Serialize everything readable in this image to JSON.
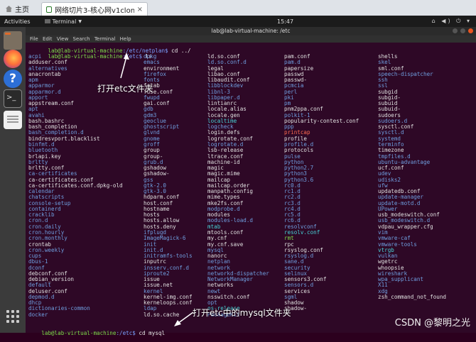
{
  "vm_tabs": {
    "home": "主页",
    "active": "网络切片3-核心网v1clone...",
    "close_glyph": "×"
  },
  "topbar": {
    "activities": "Activities",
    "app": "Terminal",
    "clock": "15:47",
    "system_icons": "⌂ ◀) ⏻ ▾"
  },
  "terminal": {
    "title": "lab@lab-virtual-machine: /etc",
    "menu": "File Edit View Search Terminal Help",
    "lines": [
      {
        "user": "lab@lab-virtual-machine",
        "path": ":/etc/netplan$",
        "cmd": " cd ../"
      },
      {
        "user": "lab@lab-virtual-machine",
        "path": ":/etc$",
        "cmd": " ls"
      }
    ],
    "last_line": {
      "user": "lab@lab-virtual-machine",
      "path": ":/etc$",
      "cmd": " cd mysql"
    },
    "columns": [
      [
        {
          "t": "acpi",
          "k": "dir"
        },
        {
          "t": "adduser.conf",
          "k": "plain"
        },
        {
          "t": "alternatives",
          "k": "dir"
        },
        {
          "t": "anacrontab",
          "k": "plain"
        },
        {
          "t": "apm",
          "k": "dir"
        },
        {
          "t": "apparmor",
          "k": "dir"
        },
        {
          "t": "apparmor.d",
          "k": "dir"
        },
        {
          "t": "apport",
          "k": "dir"
        },
        {
          "t": "appstream.conf",
          "k": "plain"
        },
        {
          "t": "apt",
          "k": "dir"
        },
        {
          "t": "avahi",
          "k": "dir"
        },
        {
          "t": "bash.bashrc",
          "k": "plain"
        },
        {
          "t": "bash_completion",
          "k": "plain"
        },
        {
          "t": "bash_completion.d",
          "k": "dir"
        },
        {
          "t": "bindresvport.blacklist",
          "k": "plain"
        },
        {
          "t": "binfmt.d",
          "k": "dir"
        },
        {
          "t": "bluetooth",
          "k": "dir"
        },
        {
          "t": "brlapi.key",
          "k": "plain"
        },
        {
          "t": "brltty",
          "k": "dir"
        },
        {
          "t": "brltty.conf",
          "k": "plain"
        },
        {
          "t": "ca-certificates",
          "k": "dir"
        },
        {
          "t": "ca-certificates.conf",
          "k": "plain"
        },
        {
          "t": "ca-certificates.conf.dpkg-old",
          "k": "plain"
        },
        {
          "t": "calendar",
          "k": "dir"
        },
        {
          "t": "chatscripts",
          "k": "dir"
        },
        {
          "t": "console-setup",
          "k": "dir"
        },
        {
          "t": "containerd",
          "k": "dir"
        },
        {
          "t": "cracklib",
          "k": "dir"
        },
        {
          "t": "cron.d",
          "k": "dir"
        },
        {
          "t": "cron.daily",
          "k": "dir"
        },
        {
          "t": "cron.hourly",
          "k": "dir"
        },
        {
          "t": "cron.monthly",
          "k": "dir"
        },
        {
          "t": "crontab",
          "k": "plain"
        },
        {
          "t": "cron.weekly",
          "k": "dir"
        },
        {
          "t": "cups",
          "k": "dir"
        },
        {
          "t": "dbus-1",
          "k": "dir"
        },
        {
          "t": "dconf",
          "k": "dir"
        },
        {
          "t": "debconf.conf",
          "k": "plain"
        },
        {
          "t": "debian_version",
          "k": "plain"
        },
        {
          "t": "default",
          "k": "dir"
        },
        {
          "t": "deluser.conf",
          "k": "plain"
        },
        {
          "t": "depmod.d",
          "k": "dir"
        },
        {
          "t": "dhcp",
          "k": "dir"
        },
        {
          "t": "dictionaries-common",
          "k": "dir"
        },
        {
          "t": "docker",
          "k": "dir"
        }
      ],
      [
        {
          "t": "dpkg",
          "k": "dir"
        },
        {
          "t": "emacs",
          "k": "dir"
        },
        {
          "t": "environment",
          "k": "plain"
        },
        {
          "t": "firefox",
          "k": "dir"
        },
        {
          "t": "fonts",
          "k": "dir"
        },
        {
          "t": "fstab",
          "k": "plain"
        },
        {
          "t": "fuse.conf",
          "k": "plain"
        },
        {
          "t": "fwupd",
          "k": "dir"
        },
        {
          "t": "gai.conf",
          "k": "plain"
        },
        {
          "t": "gdb",
          "k": "dir"
        },
        {
          "t": "gdm3",
          "k": "dir"
        },
        {
          "t": "geoclue",
          "k": "dir"
        },
        {
          "t": "ghostscript",
          "k": "dir"
        },
        {
          "t": "glvnd",
          "k": "dir"
        },
        {
          "t": "gnome",
          "k": "dir"
        },
        {
          "t": "groff",
          "k": "dir"
        },
        {
          "t": "group",
          "k": "plain"
        },
        {
          "t": "group-",
          "k": "plain"
        },
        {
          "t": "grub.d",
          "k": "dir"
        },
        {
          "t": "gshadow",
          "k": "plain"
        },
        {
          "t": "gshadow-",
          "k": "plain"
        },
        {
          "t": "gss",
          "k": "dir"
        },
        {
          "t": "gtk-2.0",
          "k": "dir"
        },
        {
          "t": "gtk-3.0",
          "k": "dir"
        },
        {
          "t": "hdparm.conf",
          "k": "plain"
        },
        {
          "t": "host.conf",
          "k": "plain"
        },
        {
          "t": "hostname",
          "k": "plain"
        },
        {
          "t": "hosts",
          "k": "plain"
        },
        {
          "t": "hosts.allow",
          "k": "plain"
        },
        {
          "t": "hosts.deny",
          "k": "plain"
        },
        {
          "t": "ifplugd",
          "k": "dir"
        },
        {
          "t": "ImageMagick-6",
          "k": "dir"
        },
        {
          "t": "init",
          "k": "dir"
        },
        {
          "t": "init.d",
          "k": "dir"
        },
        {
          "t": "initramfs-tools",
          "k": "dir"
        },
        {
          "t": "inputrc",
          "k": "plain"
        },
        {
          "t": "insserv.conf.d",
          "k": "dir"
        },
        {
          "t": "iproute2",
          "k": "dir"
        },
        {
          "t": "issue",
          "k": "plain"
        },
        {
          "t": "issue.net",
          "k": "plain"
        },
        {
          "t": "kernel",
          "k": "dir"
        },
        {
          "t": "kernel-img.conf",
          "k": "plain"
        },
        {
          "t": "kerneloops.conf",
          "k": "plain"
        },
        {
          "t": "ldap",
          "k": "dir"
        },
        {
          "t": "ld.so.cache",
          "k": "plain"
        }
      ],
      [
        {
          "t": "ld.so.conf",
          "k": "plain"
        },
        {
          "t": "ld.so.conf.d",
          "k": "dir"
        },
        {
          "t": "legal",
          "k": "plain"
        },
        {
          "t": "libao.conf",
          "k": "plain"
        },
        {
          "t": "libaudit.conf",
          "k": "plain"
        },
        {
          "t": "libblockdev",
          "k": "dir"
        },
        {
          "t": "libnl-3",
          "k": "dir"
        },
        {
          "t": "libpaper.d",
          "k": "dir"
        },
        {
          "t": "lintianrc",
          "k": "plain"
        },
        {
          "t": "locale.alias",
          "k": "plain"
        },
        {
          "t": "locale.gen",
          "k": "plain"
        },
        {
          "t": "localtime",
          "k": "link"
        },
        {
          "t": "logcheck",
          "k": "dir"
        },
        {
          "t": "login.defs",
          "k": "plain"
        },
        {
          "t": "logrotate.conf",
          "k": "plain"
        },
        {
          "t": "logrotate.d",
          "k": "dir"
        },
        {
          "t": "lsb-release",
          "k": "plain"
        },
        {
          "t": "ltrace.conf",
          "k": "plain"
        },
        {
          "t": "machine-id",
          "k": "plain"
        },
        {
          "t": "magic",
          "k": "plain"
        },
        {
          "t": "magic.mime",
          "k": "plain"
        },
        {
          "t": "mailcap",
          "k": "plain"
        },
        {
          "t": "mailcap.order",
          "k": "plain"
        },
        {
          "t": "manpath.config",
          "k": "plain"
        },
        {
          "t": "mime.types",
          "k": "plain"
        },
        {
          "t": "mke2fs.conf",
          "k": "plain"
        },
        {
          "t": "modprobe.d",
          "k": "dir"
        },
        {
          "t": "modules",
          "k": "plain"
        },
        {
          "t": "modules-load.d",
          "k": "dir"
        },
        {
          "t": "mtab",
          "k": "link"
        },
        {
          "t": "mtools.conf",
          "k": "plain"
        },
        {
          "t": "my.cnf",
          "k": "plain"
        },
        {
          "t": "my.cnf.save",
          "k": "plain"
        },
        {
          "t": "mysql",
          "k": "dir"
        },
        {
          "t": "nanorc",
          "k": "plain"
        },
        {
          "t": "netplan",
          "k": "dir"
        },
        {
          "t": "network",
          "k": "dir"
        },
        {
          "t": "networkd-dispatcher",
          "k": "dir"
        },
        {
          "t": "NetworkManager",
          "k": "dir"
        },
        {
          "t": "networks",
          "k": "plain"
        },
        {
          "t": "newt",
          "k": "dir"
        },
        {
          "t": "nsswitch.conf",
          "k": "plain"
        },
        {
          "t": "opt",
          "k": "dir"
        },
        {
          "t": "os-release",
          "k": "link"
        },
        {
          "t": "PackageKit",
          "k": "dir"
        }
      ],
      [
        {
          "t": "pam.conf",
          "k": "plain"
        },
        {
          "t": "pam.d",
          "k": "dir"
        },
        {
          "t": "papersize",
          "k": "plain"
        },
        {
          "t": "passwd",
          "k": "plain"
        },
        {
          "t": "passwd-",
          "k": "plain"
        },
        {
          "t": "pcmcia",
          "k": "dir"
        },
        {
          "t": "perl",
          "k": "dir"
        },
        {
          "t": "pki",
          "k": "dir"
        },
        {
          "t": "pm",
          "k": "dir"
        },
        {
          "t": "pnm2ppa.conf",
          "k": "plain"
        },
        {
          "t": "polkit-1",
          "k": "dir"
        },
        {
          "t": "popularity-contest.conf",
          "k": "plain"
        },
        {
          "t": "ppp",
          "k": "dir"
        },
        {
          "t": "printcap",
          "k": "warn"
        },
        {
          "t": "profile",
          "k": "plain"
        },
        {
          "t": "profile.d",
          "k": "dir"
        },
        {
          "t": "protocols",
          "k": "plain"
        },
        {
          "t": "pulse",
          "k": "dir"
        },
        {
          "t": "python",
          "k": "dir"
        },
        {
          "t": "python2.7",
          "k": "dir"
        },
        {
          "t": "python3",
          "k": "dir"
        },
        {
          "t": "python3.6",
          "k": "dir"
        },
        {
          "t": "rc0.d",
          "k": "dir"
        },
        {
          "t": "rc1.d",
          "k": "dir"
        },
        {
          "t": "rc2.d",
          "k": "dir"
        },
        {
          "t": "rc3.d",
          "k": "dir"
        },
        {
          "t": "rc4.d",
          "k": "dir"
        },
        {
          "t": "rc5.d",
          "k": "dir"
        },
        {
          "t": "rc6.d",
          "k": "dir"
        },
        {
          "t": "resolvconf",
          "k": "dir"
        },
        {
          "t": "resolv.conf",
          "k": "link"
        },
        {
          "t": "rmt",
          "k": "exe"
        },
        {
          "t": "rpc",
          "k": "plain"
        },
        {
          "t": "rsyslog.conf",
          "k": "plain"
        },
        {
          "t": "rsyslog.d",
          "k": "dir"
        },
        {
          "t": "sane.d",
          "k": "dir"
        },
        {
          "t": "security",
          "k": "dir"
        },
        {
          "t": "selinux",
          "k": "dir"
        },
        {
          "t": "sensors3.conf",
          "k": "plain"
        },
        {
          "t": "sensors.d",
          "k": "dir"
        },
        {
          "t": "services",
          "k": "plain"
        },
        {
          "t": "sgml",
          "k": "dir"
        },
        {
          "t": "shadow",
          "k": "plain"
        },
        {
          "t": "shadow-",
          "k": "plain"
        }
      ],
      [
        {
          "t": "shells",
          "k": "plain"
        },
        {
          "t": "skel",
          "k": "dir"
        },
        {
          "t": "sml.conf",
          "k": "plain"
        },
        {
          "t": "speech-dispatcher",
          "k": "dir"
        },
        {
          "t": "ssh",
          "k": "dir"
        },
        {
          "t": "ssl",
          "k": "dir"
        },
        {
          "t": "subgid",
          "k": "plain"
        },
        {
          "t": "subgid-",
          "k": "plain"
        },
        {
          "t": "subuid",
          "k": "plain"
        },
        {
          "t": "subuid-",
          "k": "plain"
        },
        {
          "t": "sudoers",
          "k": "plain"
        },
        {
          "t": "sudoers.d",
          "k": "dir"
        },
        {
          "t": "sysctl.conf",
          "k": "plain"
        },
        {
          "t": "sysctl.d",
          "k": "dir"
        },
        {
          "t": "systemd",
          "k": "dir"
        },
        {
          "t": "terminfo",
          "k": "dir"
        },
        {
          "t": "timezone",
          "k": "plain"
        },
        {
          "t": "tmpfiles.d",
          "k": "dir"
        },
        {
          "t": "ubuntu-advantage",
          "k": "dir"
        },
        {
          "t": "ucf.conf",
          "k": "plain"
        },
        {
          "t": "udev",
          "k": "dir"
        },
        {
          "t": "udisks2",
          "k": "dir"
        },
        {
          "t": "ufw",
          "k": "dir"
        },
        {
          "t": "updatedb.conf",
          "k": "plain"
        },
        {
          "t": "update-manager",
          "k": "dir"
        },
        {
          "t": "update-motd.d",
          "k": "dir"
        },
        {
          "t": "UPower",
          "k": "dir"
        },
        {
          "t": "usb_modeswitch.conf",
          "k": "plain"
        },
        {
          "t": "usb_modeswitch.d",
          "k": "dir"
        },
        {
          "t": "vdpau_wrapper.cfg",
          "k": "plain"
        },
        {
          "t": "vim",
          "k": "dir"
        },
        {
          "t": "vmware-caf",
          "k": "dir"
        },
        {
          "t": "vmware-tools",
          "k": "dir"
        },
        {
          "t": "vtrgb",
          "k": "link"
        },
        {
          "t": "vulkan",
          "k": "dir"
        },
        {
          "t": "wgetrc",
          "k": "plain"
        },
        {
          "t": "whoopsie",
          "k": "plain"
        },
        {
          "t": "wireshark",
          "k": "dir"
        },
        {
          "t": "wpa_supplicant",
          "k": "dir"
        },
        {
          "t": "X11",
          "k": "dir"
        },
        {
          "t": "xdg",
          "k": "dir"
        },
        {
          "t": "zsh_command_not_found",
          "k": "plain"
        }
      ]
    ]
  },
  "annotations": {
    "open_etc": "打开etc文件夹",
    "open_mysql": "打开etc中的mysql文件夹"
  },
  "watermark": "CSDN @黎明之光"
}
